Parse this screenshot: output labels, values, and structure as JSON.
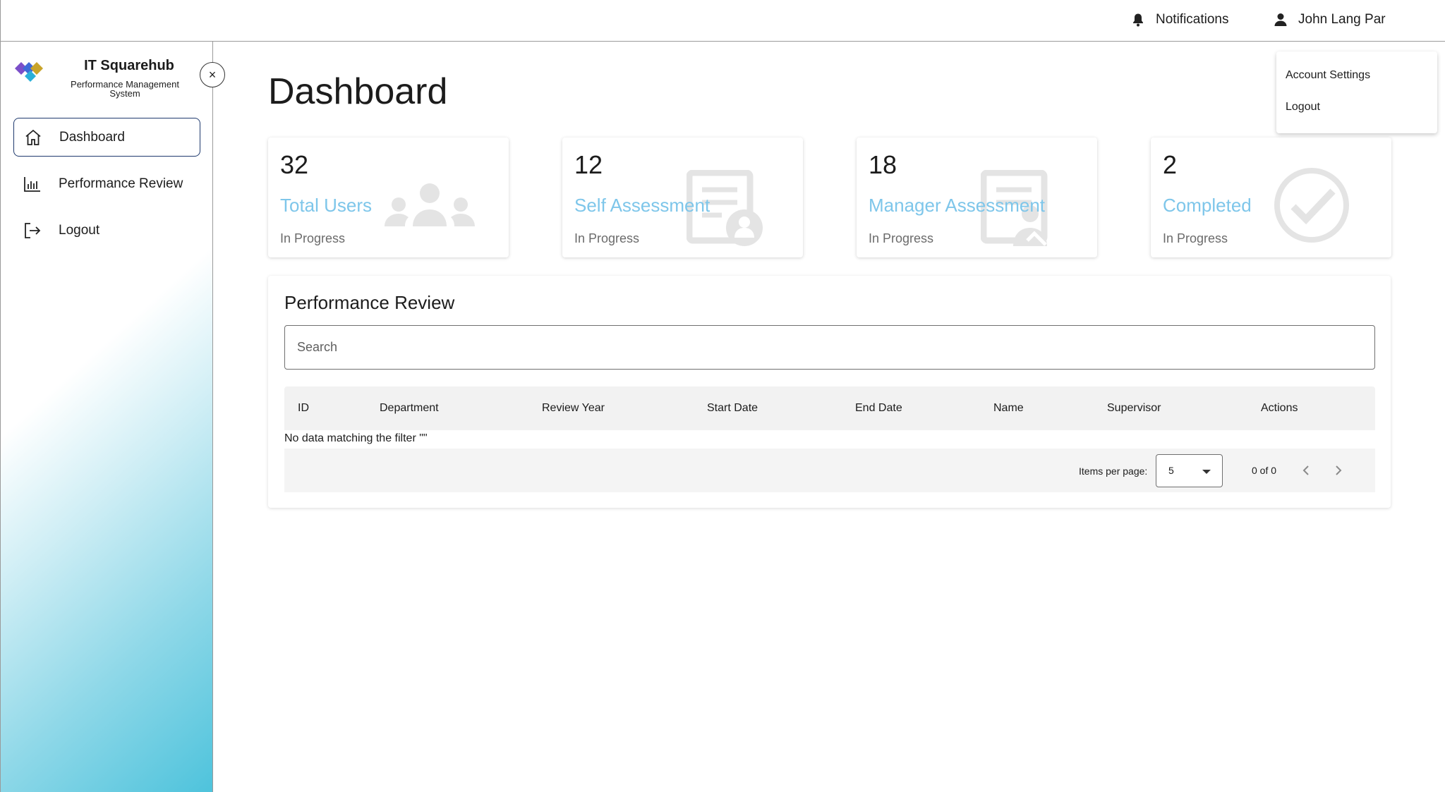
{
  "topbar": {
    "notifications_label": "Notifications",
    "user_name": "John Lang Par"
  },
  "account_menu": {
    "items": [
      "Account Settings",
      "Logout"
    ]
  },
  "sidebar": {
    "brand_name": "IT Squarehub",
    "brand_subtitle_line1": "Performance Management",
    "brand_subtitle_line2": "System",
    "close_label": "×",
    "items": [
      {
        "label": "Dashboard",
        "icon": "home-icon",
        "active": true
      },
      {
        "label": "Performance Review",
        "icon": "bar-chart-icon",
        "active": false
      },
      {
        "label": "Logout",
        "icon": "logout-icon",
        "active": false
      }
    ]
  },
  "main": {
    "title": "Dashboard",
    "cards": [
      {
        "count": "32",
        "label": "Total Users",
        "status": "In Progress",
        "icon": "users-group-icon"
      },
      {
        "count": "12",
        "label": "Self Assessment",
        "status": "In Progress",
        "icon": "self-assessment-icon"
      },
      {
        "count": "18",
        "label": "Manager Assessment",
        "status": "In Progress",
        "icon": "manager-assessment-icon"
      },
      {
        "count": "2",
        "label": "Completed",
        "status": "In Progress",
        "icon": "check-circle-icon"
      }
    ],
    "review": {
      "title": "Performance Review",
      "search_placeholder": "Search",
      "columns": [
        "ID",
        "Department",
        "Review Year",
        "Start Date",
        "End Date",
        "Name",
        "Supervisor",
        "Actions"
      ],
      "empty_message": "No data matching the filter \"\"",
      "items_per_page_label": "Items per page:",
      "items_per_page_value": "5",
      "range_label": "0 of 0"
    }
  },
  "colors": {
    "card_label": "#7ec6ea",
    "nav_active_border": "#1f3a6e",
    "sidebar_gradient_end": "#4ec3dc"
  }
}
